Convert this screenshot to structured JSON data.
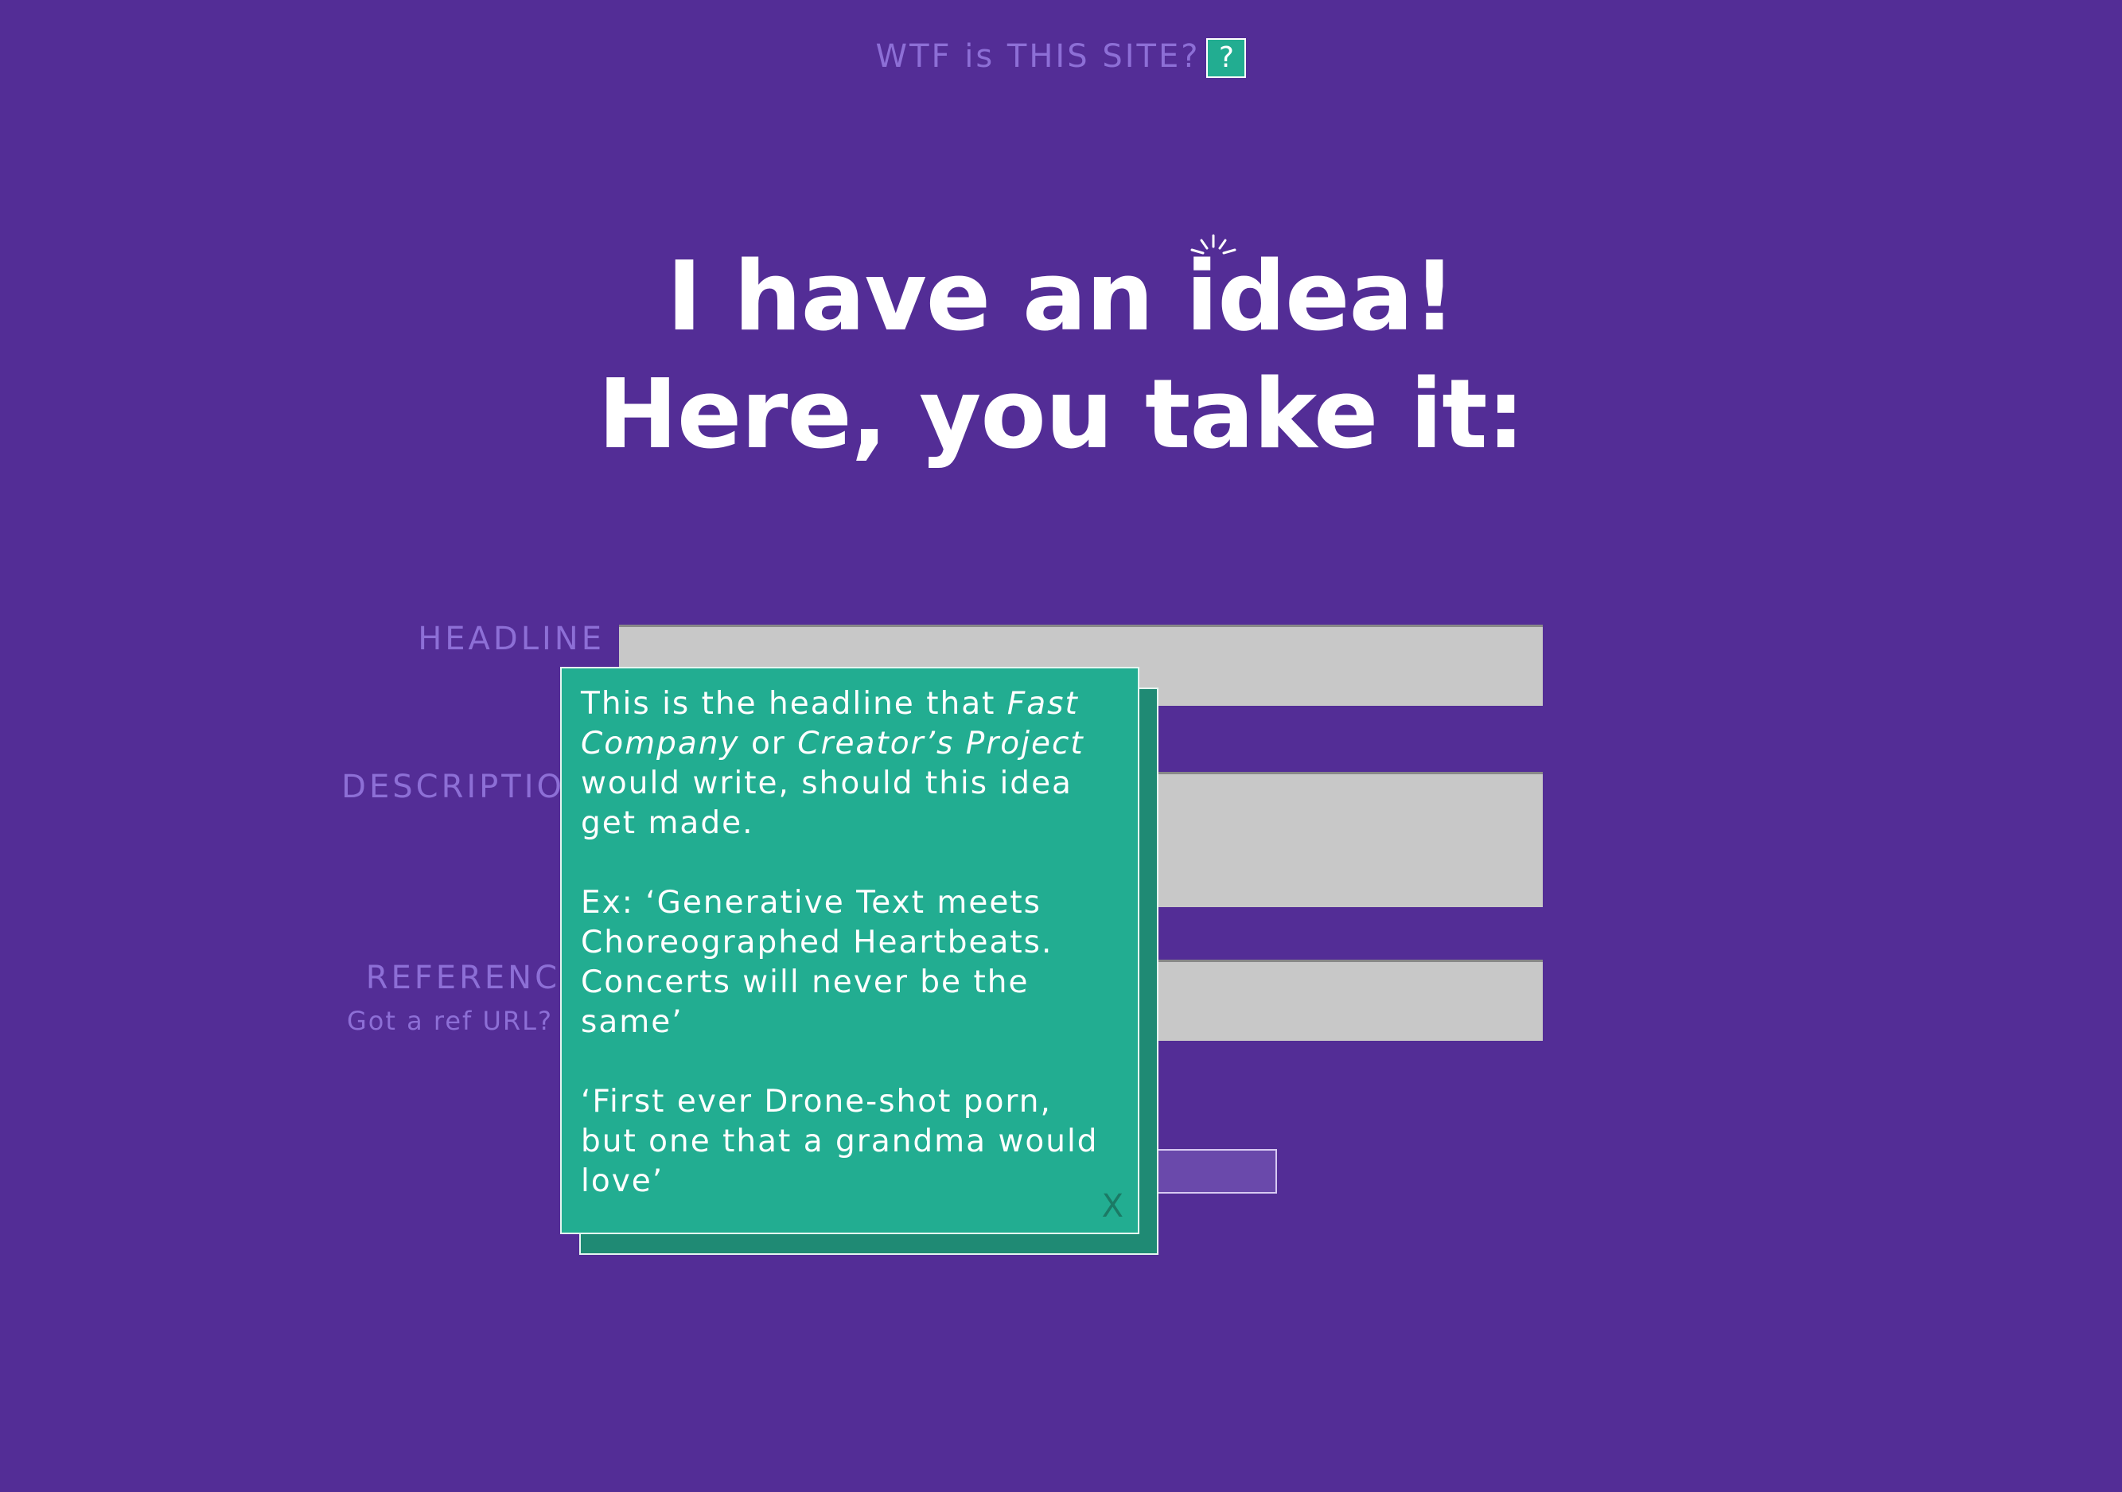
{
  "topbar": {
    "text": "WTF is THIS SITE?",
    "help_icon": "?"
  },
  "hero": {
    "line1_prefix": "I have an ",
    "line1_word": "idea!",
    "line2": "Here, you take it:"
  },
  "form": {
    "headline_label": "HEADLINE",
    "description_label": "DESCRIPTIO",
    "reference_label": "REFERENC",
    "reference_hint": "Got a ref URL?",
    "headline_value": "",
    "description_value": "",
    "reference_value": ""
  },
  "tooltip": {
    "p1_a": "This is the headline that ",
    "p1_em1": "Fast Company",
    "p1_b": " or ",
    "p1_em2": "Creator’s Project",
    "p1_c": " would write, should this idea get made.",
    "p2": "Ex: ‘Generative Text meets Choreographed Heartbeats. Concerts will never be the same’",
    "p3": "‘First ever Drone-shot porn, but one that a grandma would love’",
    "close": "X"
  },
  "colors": {
    "background": "#532d96",
    "accent": "#22ad91",
    "label": "#8d6fd6"
  }
}
